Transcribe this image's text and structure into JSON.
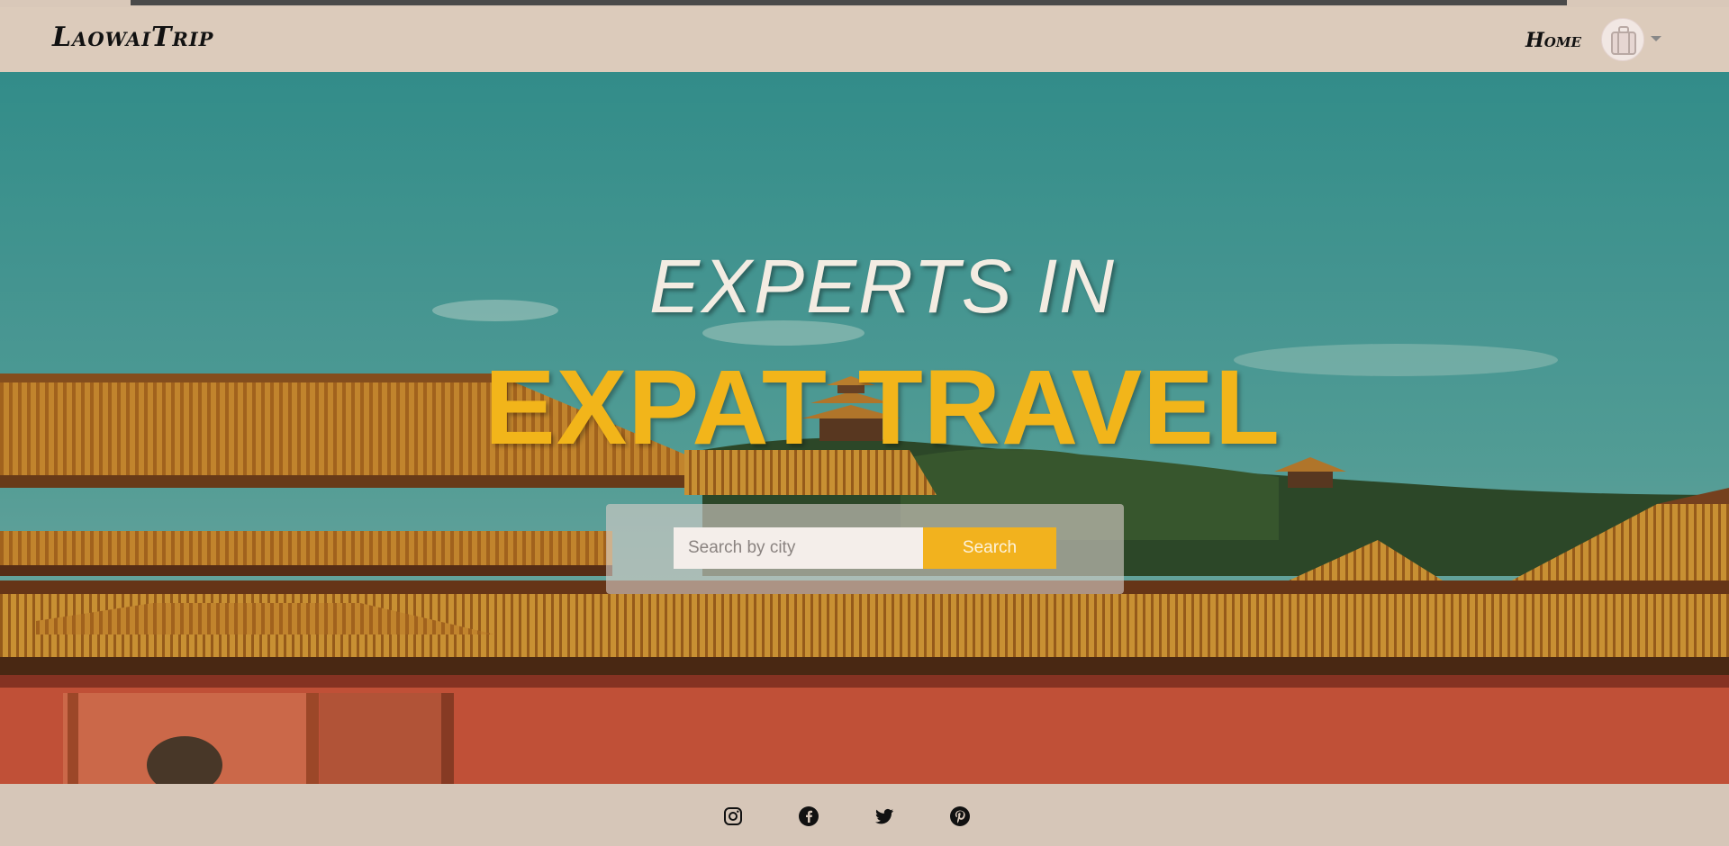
{
  "navbar": {
    "brand": "LaowaiTrip",
    "home_label": "Home"
  },
  "hero": {
    "line1": "EXPERTS IN",
    "line2": "EXPAT TRAVEL"
  },
  "search": {
    "placeholder": "Search by city",
    "button_label": "Search"
  },
  "footer": {
    "social_icons": [
      "instagram-icon",
      "facebook-icon",
      "twitter-icon",
      "pinterest-icon"
    ]
  },
  "colors": {
    "accent": "#f2b21e",
    "navbar_bg": "#dccbbb",
    "sky": "#3d9a98",
    "wall": "#c8543a"
  }
}
